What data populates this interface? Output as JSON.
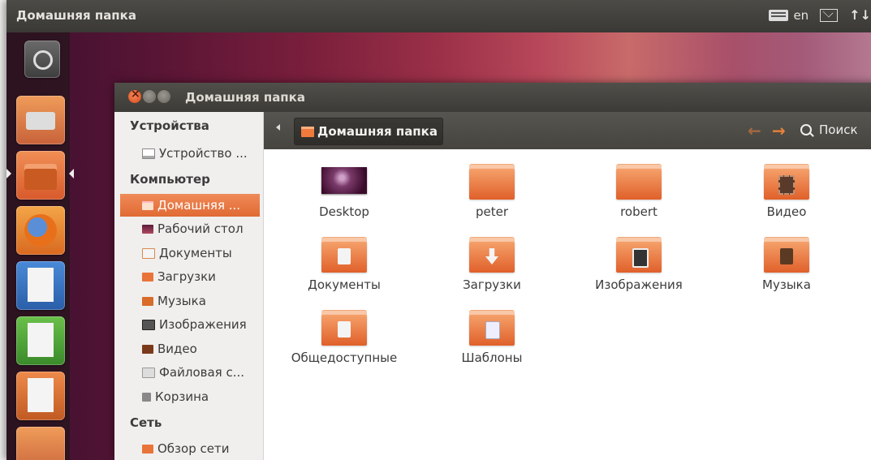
{
  "top_panel": {
    "title": "Домашняя папка",
    "keyboard_layout": "en"
  },
  "window": {
    "title": "Домашняя папка"
  },
  "sidebar": {
    "sections": [
      {
        "heading": "Устройства",
        "items": [
          "Устройство ..."
        ]
      },
      {
        "heading": "Компьютер",
        "items": [
          "Домашняя ...",
          "Рабочий стол",
          "Документы",
          "Загрузки",
          "Музыка",
          "Изображения",
          "Видео",
          "Файловая с...",
          "Корзина"
        ]
      },
      {
        "heading": "Сеть",
        "items": [
          "Обзор сети"
        ]
      }
    ],
    "active_item": "Домашняя ..."
  },
  "toolbar": {
    "breadcrumb": "Домашняя папка",
    "search_label": "Поиск"
  },
  "files": [
    {
      "name": "Desktop",
      "icon": "desktop-thumbnail"
    },
    {
      "name": "peter",
      "icon": "folder-icon"
    },
    {
      "name": "robert",
      "icon": "folder-icon"
    },
    {
      "name": "Видео",
      "icon": "video-folder-icon"
    },
    {
      "name": "Документы",
      "icon": "documents-folder-icon"
    },
    {
      "name": "Загрузки",
      "icon": "downloads-folder-icon"
    },
    {
      "name": "Изображения",
      "icon": "pictures-folder-icon"
    },
    {
      "name": "Музыка",
      "icon": "music-folder-icon"
    },
    {
      "name": "Общедоступные",
      "icon": "public-folder-icon"
    },
    {
      "name": "Шаблоны",
      "icon": "templates-folder-icon"
    }
  ],
  "colors": {
    "accent": "#e8703a",
    "panel": "#3c3b37"
  }
}
